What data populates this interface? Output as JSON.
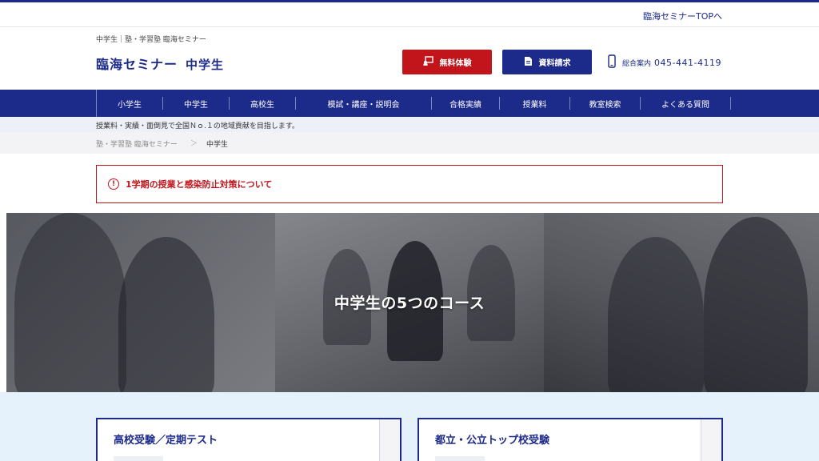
{
  "topbar": {
    "link": "臨海セミナーTOPへ"
  },
  "header": {
    "tagline": "中学生｜塾・学習塾 臨海セミナー",
    "logo": "臨海セミナー",
    "logo_sub": "中学生",
    "trial_button": "無料体験",
    "doc_button": "資料請求",
    "contact_label": "総合案内",
    "phone": "045-441-4119"
  },
  "nav": {
    "items": [
      "小学生",
      "中学生",
      "高校生",
      "模試・講座・説明会",
      "合格実績",
      "授業料",
      "教室検索",
      "よくある質問"
    ]
  },
  "sub_tag": "授業料・実績・面倒見で全国Ｎｏ.１の地域貢献を目指します。",
  "breadcrumb": {
    "home": "塾・学習塾 臨海セミナー",
    "separator": "＞",
    "current": "中学生"
  },
  "notice": {
    "text": "1学期の授業と感染防止対策について"
  },
  "hero": {
    "title": "中学生の5つのコース"
  },
  "courses": [
    {
      "title": "高校受験／定期テスト"
    },
    {
      "title": "都立・公立トップ校受験"
    }
  ],
  "colors": {
    "primary": "#1c2a8a",
    "accent_red": "#c2141b",
    "course_bg": "#e6f2fb"
  }
}
